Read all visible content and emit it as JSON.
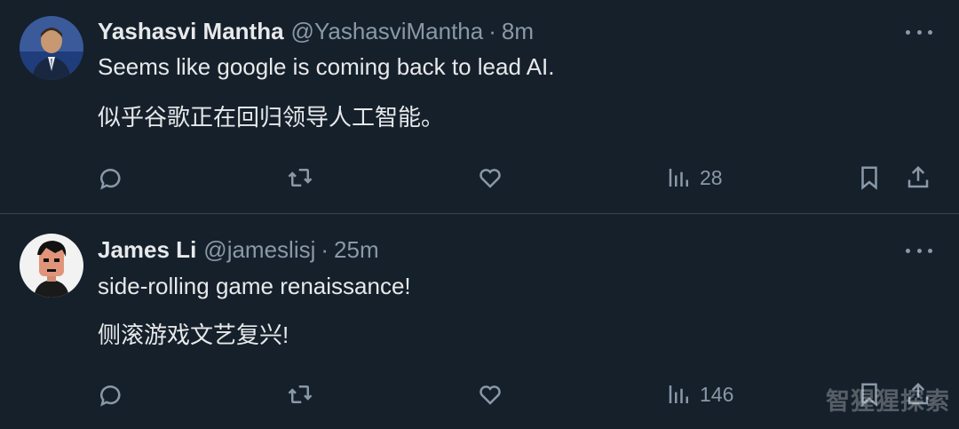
{
  "tweets": [
    {
      "name": "Yashasvi Mantha",
      "handle": "@YashasviMantha",
      "separator": "·",
      "time": "8m",
      "text_en": "Seems like google is coming back to lead AI.",
      "text_zh": "似乎谷歌正在回归领导人工智能。",
      "views": "28"
    },
    {
      "name": "James Li",
      "handle": "@jameslisj",
      "separator": "·",
      "time": "25m",
      "text_en": "side-rolling game renaissance!",
      "text_zh": "侧滚游戏文艺复兴!",
      "views": "146"
    }
  ],
  "watermark": "智猩猩探索",
  "colors": {
    "background": "#15202b",
    "text_primary": "#e7e9ea",
    "text_secondary": "#8b98a5",
    "divider": "#38444d"
  },
  "icons": [
    "reply-icon",
    "retweet-icon",
    "like-icon",
    "views-icon",
    "bookmark-icon",
    "share-icon",
    "more-icon"
  ]
}
